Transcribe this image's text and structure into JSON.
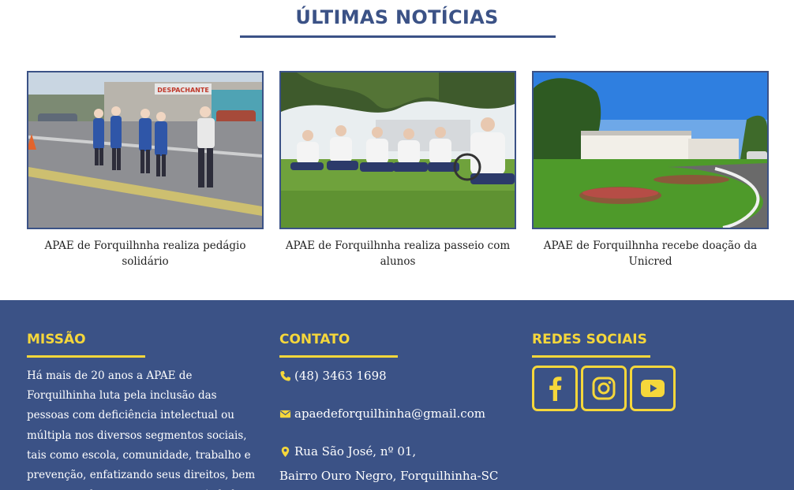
{
  "news": {
    "title": "ÚLTIMAS NOTÍCIAS",
    "items": [
      {
        "caption": "APAE de Forquilhnha realiza pedágio solidário",
        "image": "group-on-street-photo",
        "sign_text": "DESPACHANTE"
      },
      {
        "caption": "APAE de Forquilhnha realiza passeio com alunos",
        "image": "group-on-grass-photo"
      },
      {
        "caption": "APAE de Forquilhnha recebe doação da Unicred",
        "image": "garden-building-photo"
      }
    ]
  },
  "footer": {
    "mission": {
      "heading": "MISSÃO",
      "text": "Há mais de 20 anos a APAE de Forquilhinha luta pela inclusão das pessoas com deficiência intelectual ou múltipla nos diversos segmentos sociais, tais como escola, comunidade, trabalho e prevenção, enfatizando seus direitos, bem como seus deveres perante a sociedade."
    },
    "contact": {
      "heading": "CONTATO",
      "phone": "(48) 3463 1698",
      "email": "apaedeforquilhinha@gmail.com",
      "address_line1": "Rua São José, nº 01,",
      "address_line2": "Bairro Ouro Negro, Forquilhinha-SC",
      "icons": [
        "phone-icon",
        "envelope-icon",
        "map-marker-icon"
      ]
    },
    "social": {
      "heading": "REDES SOCIAIS",
      "icons": [
        "facebook-icon",
        "instagram-icon",
        "youtube-icon"
      ]
    }
  },
  "colors": {
    "primary_blue": "#3b5286",
    "accent_yellow": "#f5d73b",
    "text_dark": "#222222",
    "white": "#ffffff"
  }
}
